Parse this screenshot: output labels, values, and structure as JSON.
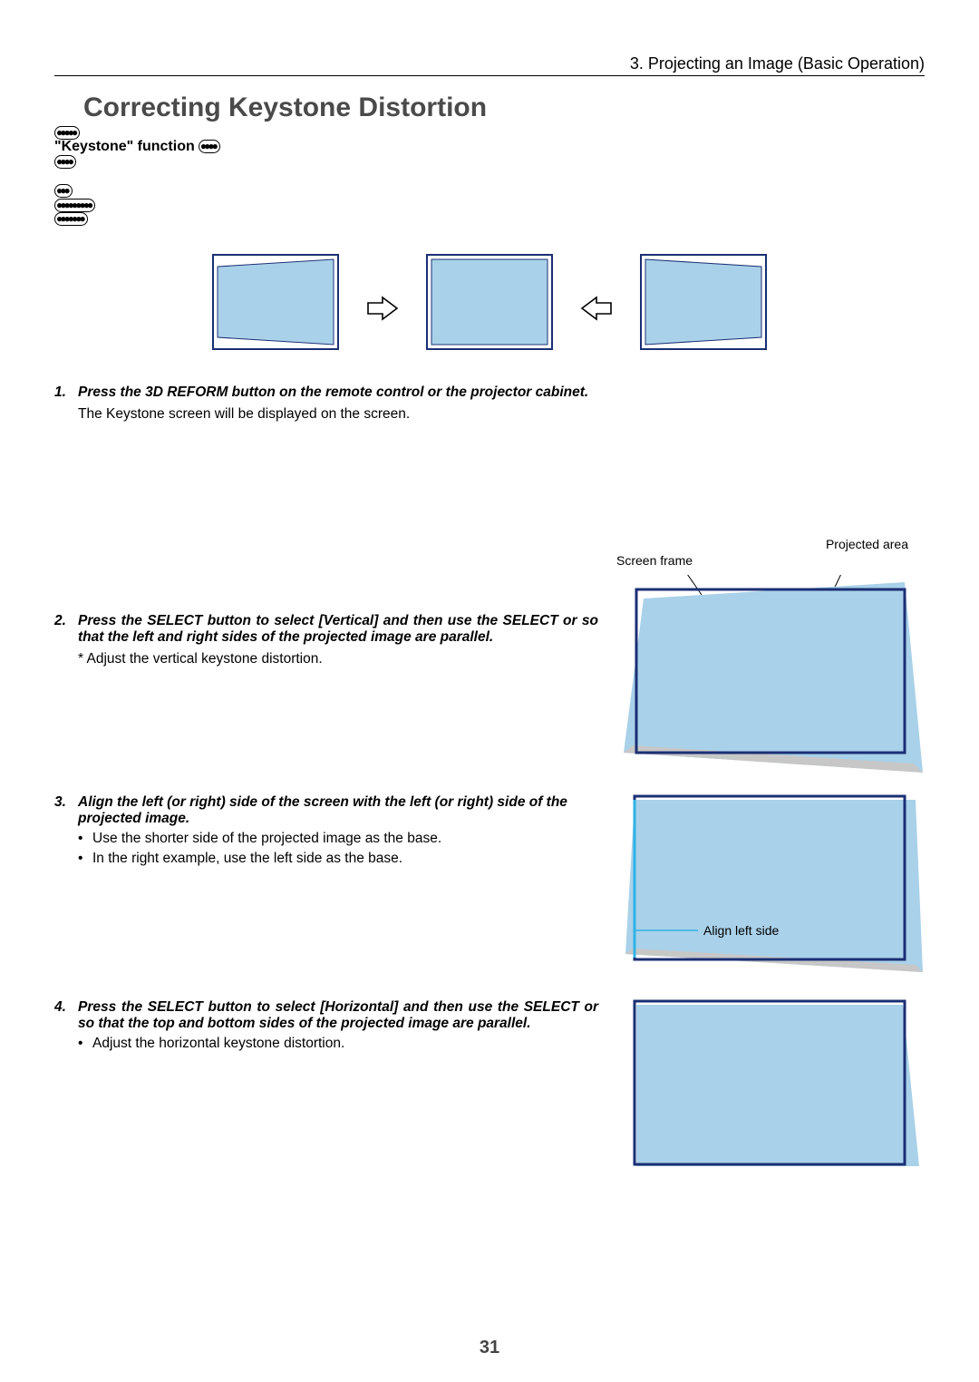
{
  "header": "3. Projecting an Image (Basic Operation)",
  "title": "Correcting Keystone Distortion",
  "intro": {
    "kw": "\"Keystone\" function"
  },
  "step1": {
    "num": "1.",
    "heading": "Press the 3D REFORM button on the remote control or the projector cabinet.",
    "desc": "The Keystone screen will be displayed on the screen."
  },
  "diagram2": {
    "screen_frame": "Screen frame",
    "projected_area": "Projected area"
  },
  "step2": {
    "num": "2.",
    "heading": "Press the SELECT     button to select [Vertical] and then use the SELECT     or     so that the left and right sides of the projected image are parallel.",
    "desc": "* Adjust the vertical keystone distortion."
  },
  "step3": {
    "num": "3.",
    "heading": "Align the left (or right) side of the screen with the left (or right) side of the projected image.",
    "b1": "Use the shorter side of the projected image as the base.",
    "b2": "In the right example, use the left side as the base.",
    "align_label": "Align left side"
  },
  "step4": {
    "num": "4.",
    "heading": "Press the SELECT     button to select [Horizontal] and then use the SELECT     or     so that the top and bottom sides of the projected image are parallel.",
    "b1": "Adjust the horizontal keystone distortion."
  },
  "page_number": "31"
}
